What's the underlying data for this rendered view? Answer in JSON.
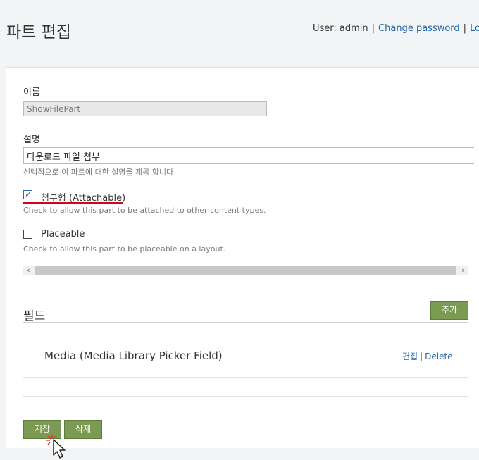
{
  "header": {
    "title": "파트 편집",
    "user_label": "User: admin",
    "separator": "|",
    "change_password": "Change password",
    "logout": "Logo"
  },
  "form": {
    "name": {
      "label": "이름",
      "value": "ShowFilePart"
    },
    "description": {
      "label": "설명",
      "value": "다운로드 파일 첨부",
      "hint": "선택적으로 이 파트에 대한 설명을 제공 합니다"
    },
    "attachable": {
      "label": "첨부형 (Attachable)",
      "checked": true,
      "hint": "Check to allow this part to be attached to other content types."
    },
    "placeable": {
      "label": "Placeable",
      "checked": false,
      "hint": "Check to allow this part to be placeable on a layout."
    },
    "scrollbar": {
      "left_arrow": "‹",
      "right_arrow": "›"
    }
  },
  "fields_section": {
    "title": "필드",
    "add_button": "추가",
    "items": [
      {
        "name": "Media (Media Library Picker Field)",
        "edit": "편집",
        "separator": "|",
        "delete": "Delete"
      }
    ]
  },
  "actions": {
    "save": "저장",
    "delete": "삭제"
  },
  "colors": {
    "link": "#2066a8",
    "button_green": "#7b9a52",
    "highlight_red": "#d9001a"
  }
}
